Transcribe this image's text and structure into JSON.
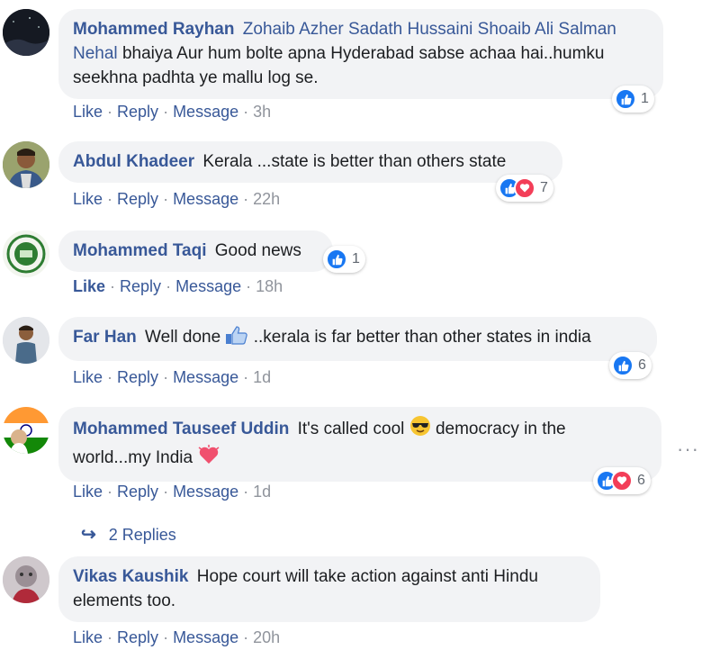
{
  "comments": [
    {
      "author": "Mohammed Rayhan",
      "mentions": "Zohaib Azher Sadath Hussaini Shoaib Ali Salman Nehal",
      "text": "bhaiya Aur hum bolte apna Hyderabad sabse achaa hai..humku seekhna padhta ye mallu log se.",
      "time": "3h",
      "reaction_count": "1"
    },
    {
      "author": "Abdul Khadeer",
      "text": "Kerala ...state is better than others state",
      "time": "22h",
      "reaction_count": "7"
    },
    {
      "author": "Mohammed Taqi",
      "text": "Good news",
      "time": "18h",
      "reaction_count": "1"
    },
    {
      "author": "Far Han",
      "text_before": "Well done",
      "text_after": "..kerala is far better than other states in india",
      "time": "1d",
      "reaction_count": "6"
    },
    {
      "author": "Mohammed Tauseef Uddin",
      "text_before": "It's called cool",
      "text_middle": "democracy in the world...my India",
      "time": "1d",
      "reaction_count": "6"
    },
    {
      "author": "Vikas Kaushik",
      "text": "Hope court will take action against anti Hindu elements too.",
      "time": "20h"
    }
  ],
  "actions": {
    "like": "Like",
    "reply": "Reply",
    "message": "Message"
  },
  "replies_link": "2 Replies",
  "colors": {
    "link": "#385898",
    "bubble": "#f2f3f5",
    "like": "#1877f2",
    "love": "#f33e58",
    "meta": "#90949c"
  },
  "icons": [
    "like-reaction-icon",
    "love-reaction-icon",
    "thumbs-up-emoji-icon",
    "cool-face-emoji-icon",
    "heart-emoji-icon",
    "reply-arrow-icon",
    "more-options-icon"
  ]
}
